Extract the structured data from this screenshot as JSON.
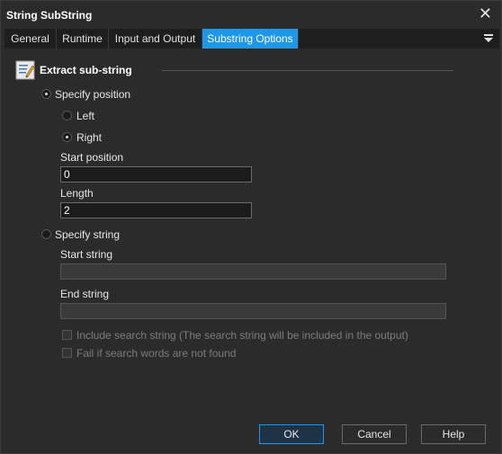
{
  "window": {
    "title": "String SubString"
  },
  "tabs": [
    {
      "label": "General"
    },
    {
      "label": "Runtime"
    },
    {
      "label": "Input and Output"
    },
    {
      "label": "Substring Options",
      "active": true
    }
  ],
  "group": {
    "title": "Extract sub-string",
    "icon": "edit-text-icon"
  },
  "position_mode": {
    "label": "Specify position",
    "selected": true,
    "left_label": "Left",
    "right_label": "Right",
    "right_selected": true,
    "start_label": "Start position",
    "start_value": "0",
    "length_label": "Length",
    "length_value": "2"
  },
  "string_mode": {
    "label": "Specify string",
    "selected": false,
    "start_label": "Start string",
    "start_value": "",
    "end_label": "End string",
    "end_value": "",
    "include_label": "Include search string (The search string will be included in the output)",
    "fail_label": "Fail if search words are not found"
  },
  "buttons": {
    "ok": "OK",
    "cancel": "Cancel",
    "help": "Help"
  },
  "colors": {
    "accent": "#1c97ea",
    "background": "#2b2b2b"
  }
}
